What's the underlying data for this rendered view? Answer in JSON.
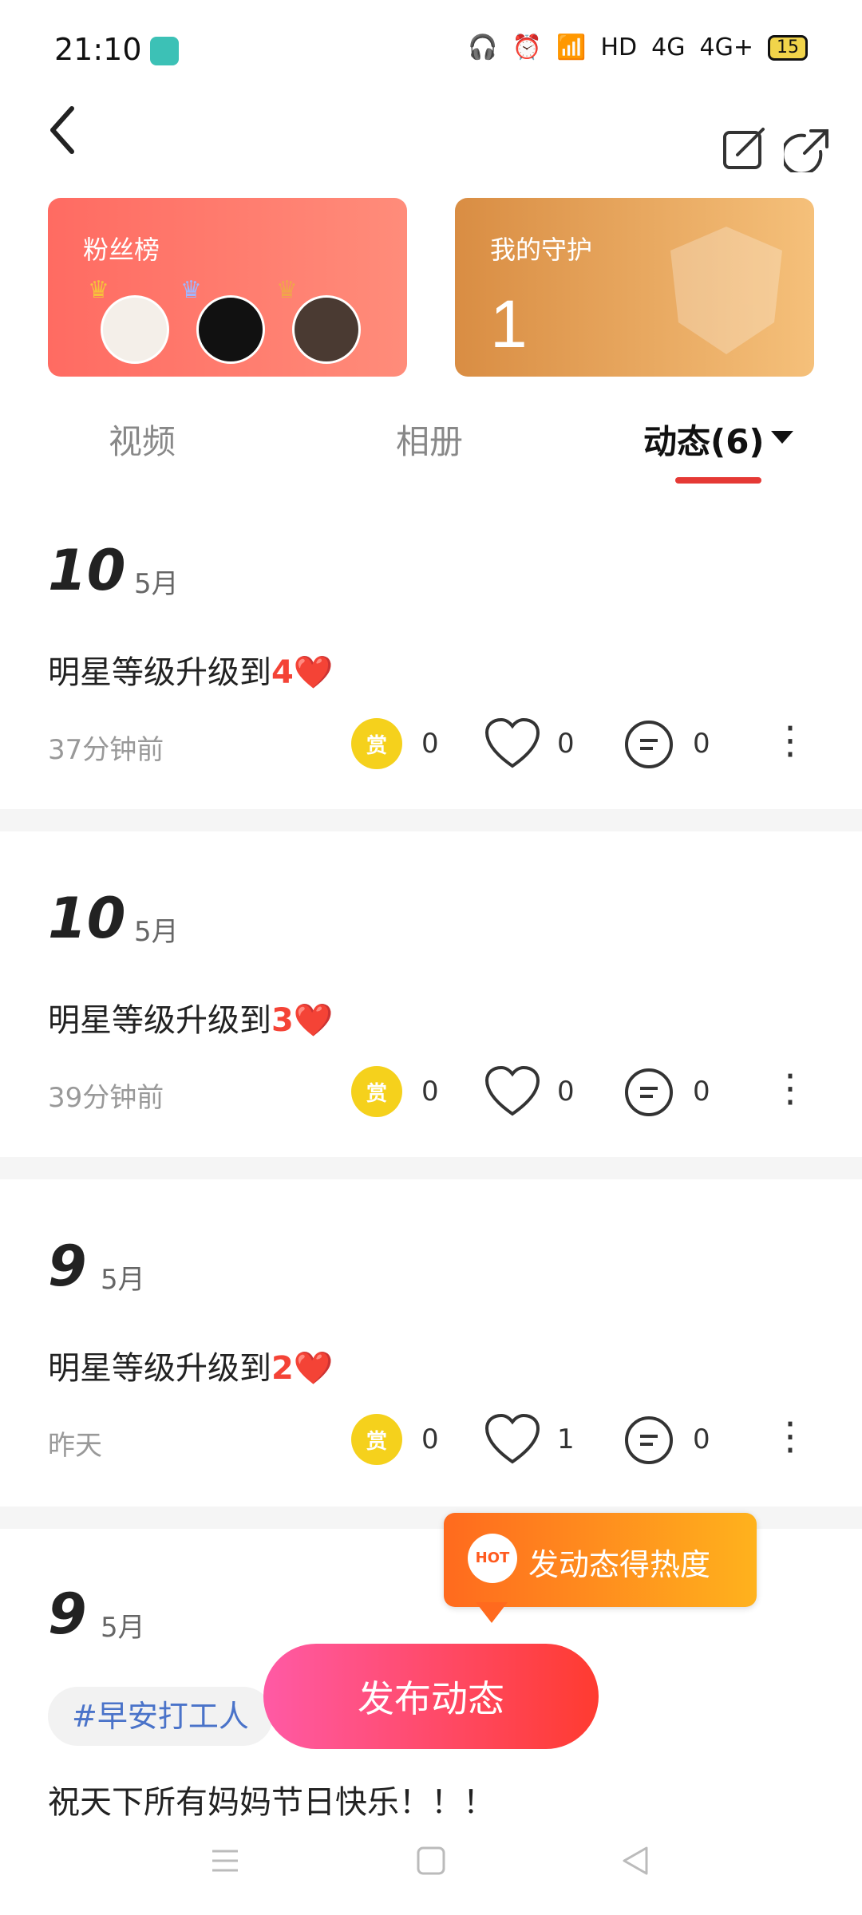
{
  "status_bar": {
    "time": "21:10",
    "network": "HD",
    "sim1": "4G",
    "sim2": "4G+",
    "battery": "15"
  },
  "cards": {
    "fans": {
      "title": "粉丝榜"
    },
    "guard": {
      "title": "我的守护",
      "count": "1"
    }
  },
  "tabs": {
    "videos": "视频",
    "album": "相册",
    "moments": "动态(6)"
  },
  "posts": [
    {
      "day": "10",
      "month": "5月",
      "text": "明星等级升级到",
      "level": "4",
      "time": "37分钟前",
      "reward": "赏",
      "reward_count": "0",
      "likes": "0",
      "comments": "0"
    },
    {
      "day": "10",
      "month": "5月",
      "text": "明星等级升级到",
      "level": "3",
      "time": "39分钟前",
      "reward": "赏",
      "reward_count": "0",
      "likes": "0",
      "comments": "0"
    },
    {
      "day": "9",
      "month": "5月",
      "text": "明星等级升级到",
      "level": "2",
      "time": "昨天",
      "reward": "赏",
      "reward_count": "0",
      "likes": "1",
      "comments": "0"
    },
    {
      "day": "9",
      "month": "5月",
      "hashtag": "#早安打工人",
      "text": "祝天下所有妈妈节日快乐！！！"
    }
  ],
  "hot_tip": {
    "badge": "HOT",
    "text": "发动态得热度"
  },
  "publish_button": "发布动态"
}
